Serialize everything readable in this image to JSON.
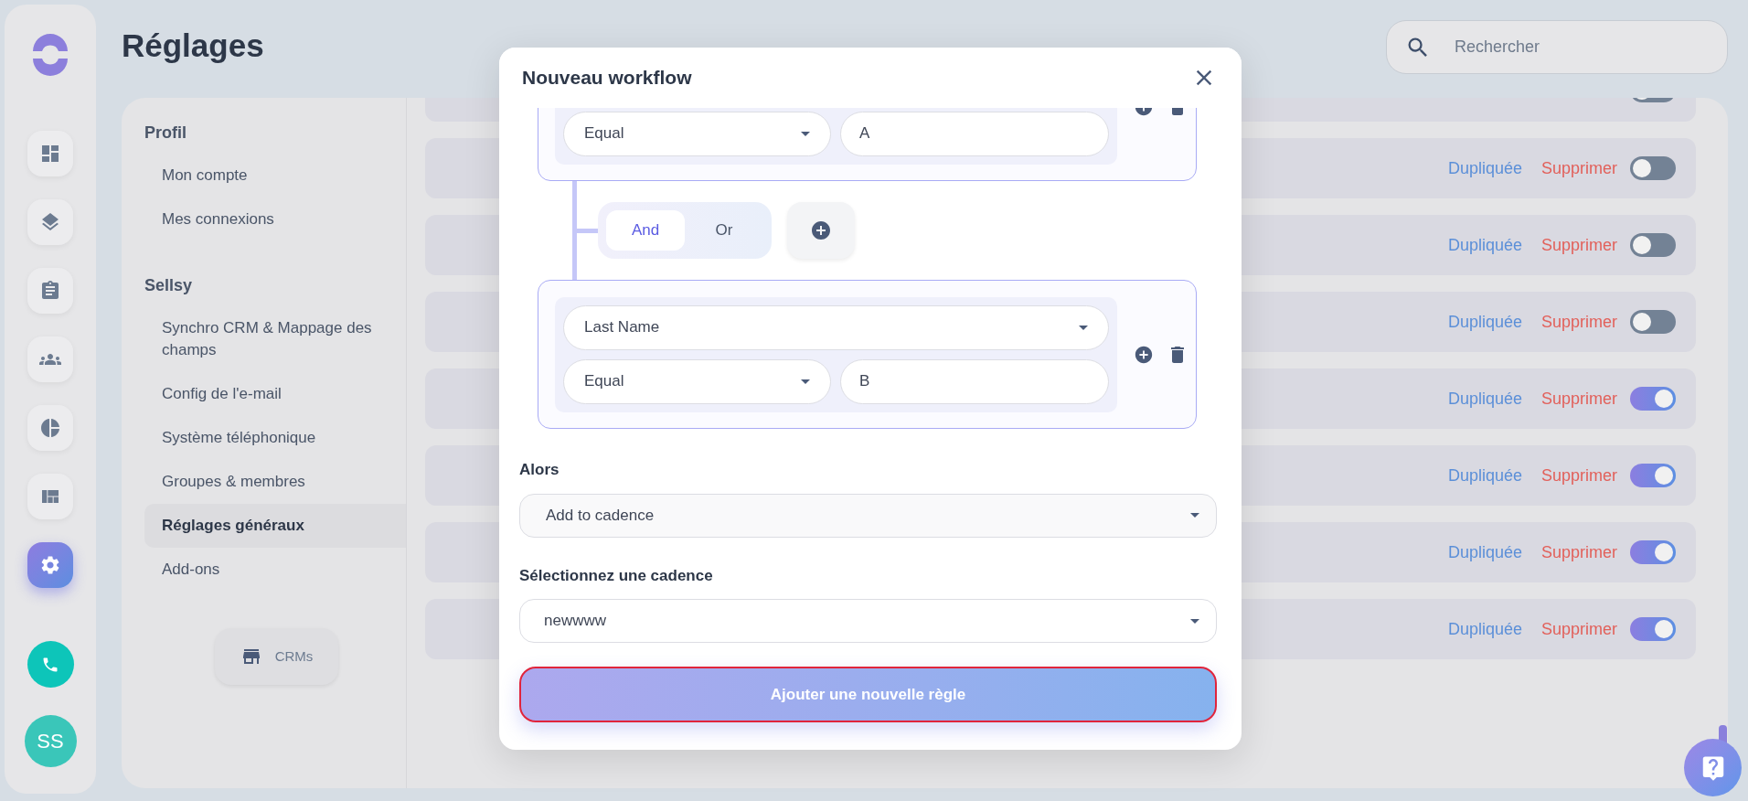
{
  "rail": {
    "items": [
      {
        "kind": "dashboard",
        "selected": false
      },
      {
        "kind": "layers",
        "selected": false
      },
      {
        "kind": "clipboard",
        "selected": false
      },
      {
        "kind": "people",
        "selected": false
      },
      {
        "kind": "pie",
        "selected": false
      },
      {
        "kind": "layout",
        "selected": false
      },
      {
        "kind": "settings",
        "selected": true
      }
    ],
    "avatar": "SS"
  },
  "page_title": "Réglages",
  "search": {
    "placeholder": "Rechercher"
  },
  "settings_nav": {
    "sections": [
      {
        "title": "Profil",
        "items": [
          {
            "label": "Mon compte",
            "selected": false
          },
          {
            "label": "Mes connexions",
            "selected": false
          }
        ]
      },
      {
        "title": "Sellsy",
        "items": [
          {
            "label": "Synchro CRM & Mappage des champs",
            "selected": false
          },
          {
            "label": "Config de l'e-mail",
            "selected": false
          },
          {
            "label": "Système téléphonique",
            "selected": false
          },
          {
            "label": "Groupes & membres",
            "selected": false
          },
          {
            "label": "Réglages généraux",
            "selected": true
          },
          {
            "label": "Add-ons",
            "selected": false
          }
        ]
      }
    ],
    "crms_button": "CRMs"
  },
  "workflows": {
    "rows": [
      {
        "kind": "cut",
        "on": false
      },
      {
        "kind": "full",
        "duplicate": "Dupliquée",
        "delete": "Supprimer",
        "on": false
      },
      {
        "kind": "full",
        "duplicate": "Dupliquée",
        "delete": "Supprimer",
        "on": false
      },
      {
        "kind": "full",
        "duplicate": "Dupliquée",
        "delete": "Supprimer",
        "on": false
      },
      {
        "kind": "full",
        "duplicate": "Dupliquée",
        "delete": "Supprimer",
        "on": true
      },
      {
        "kind": "full",
        "duplicate": "Dupliquée",
        "delete": "Supprimer",
        "on": true
      },
      {
        "kind": "full",
        "duplicate": "Dupliquée",
        "delete": "Supprimer",
        "on": true
      },
      {
        "kind": "full",
        "duplicate": "Dupliquée",
        "delete": "Supprimer",
        "on": true
      }
    ]
  },
  "modal": {
    "title": "Nouveau workflow",
    "conditions": [
      {
        "operator": "Equal",
        "value": "A"
      },
      {
        "field": "Last Name",
        "operator": "Equal",
        "value": "B"
      }
    ],
    "connector": {
      "options": [
        {
          "label": "And",
          "selected": true
        },
        {
          "label": "Or",
          "selected": false
        }
      ]
    },
    "then_label": "Alors",
    "action": "Add to cadence",
    "cadence_label": "Sélectionnez une cadence",
    "cadence": "newwww",
    "submit": "Ajouter une nouvelle règle"
  }
}
